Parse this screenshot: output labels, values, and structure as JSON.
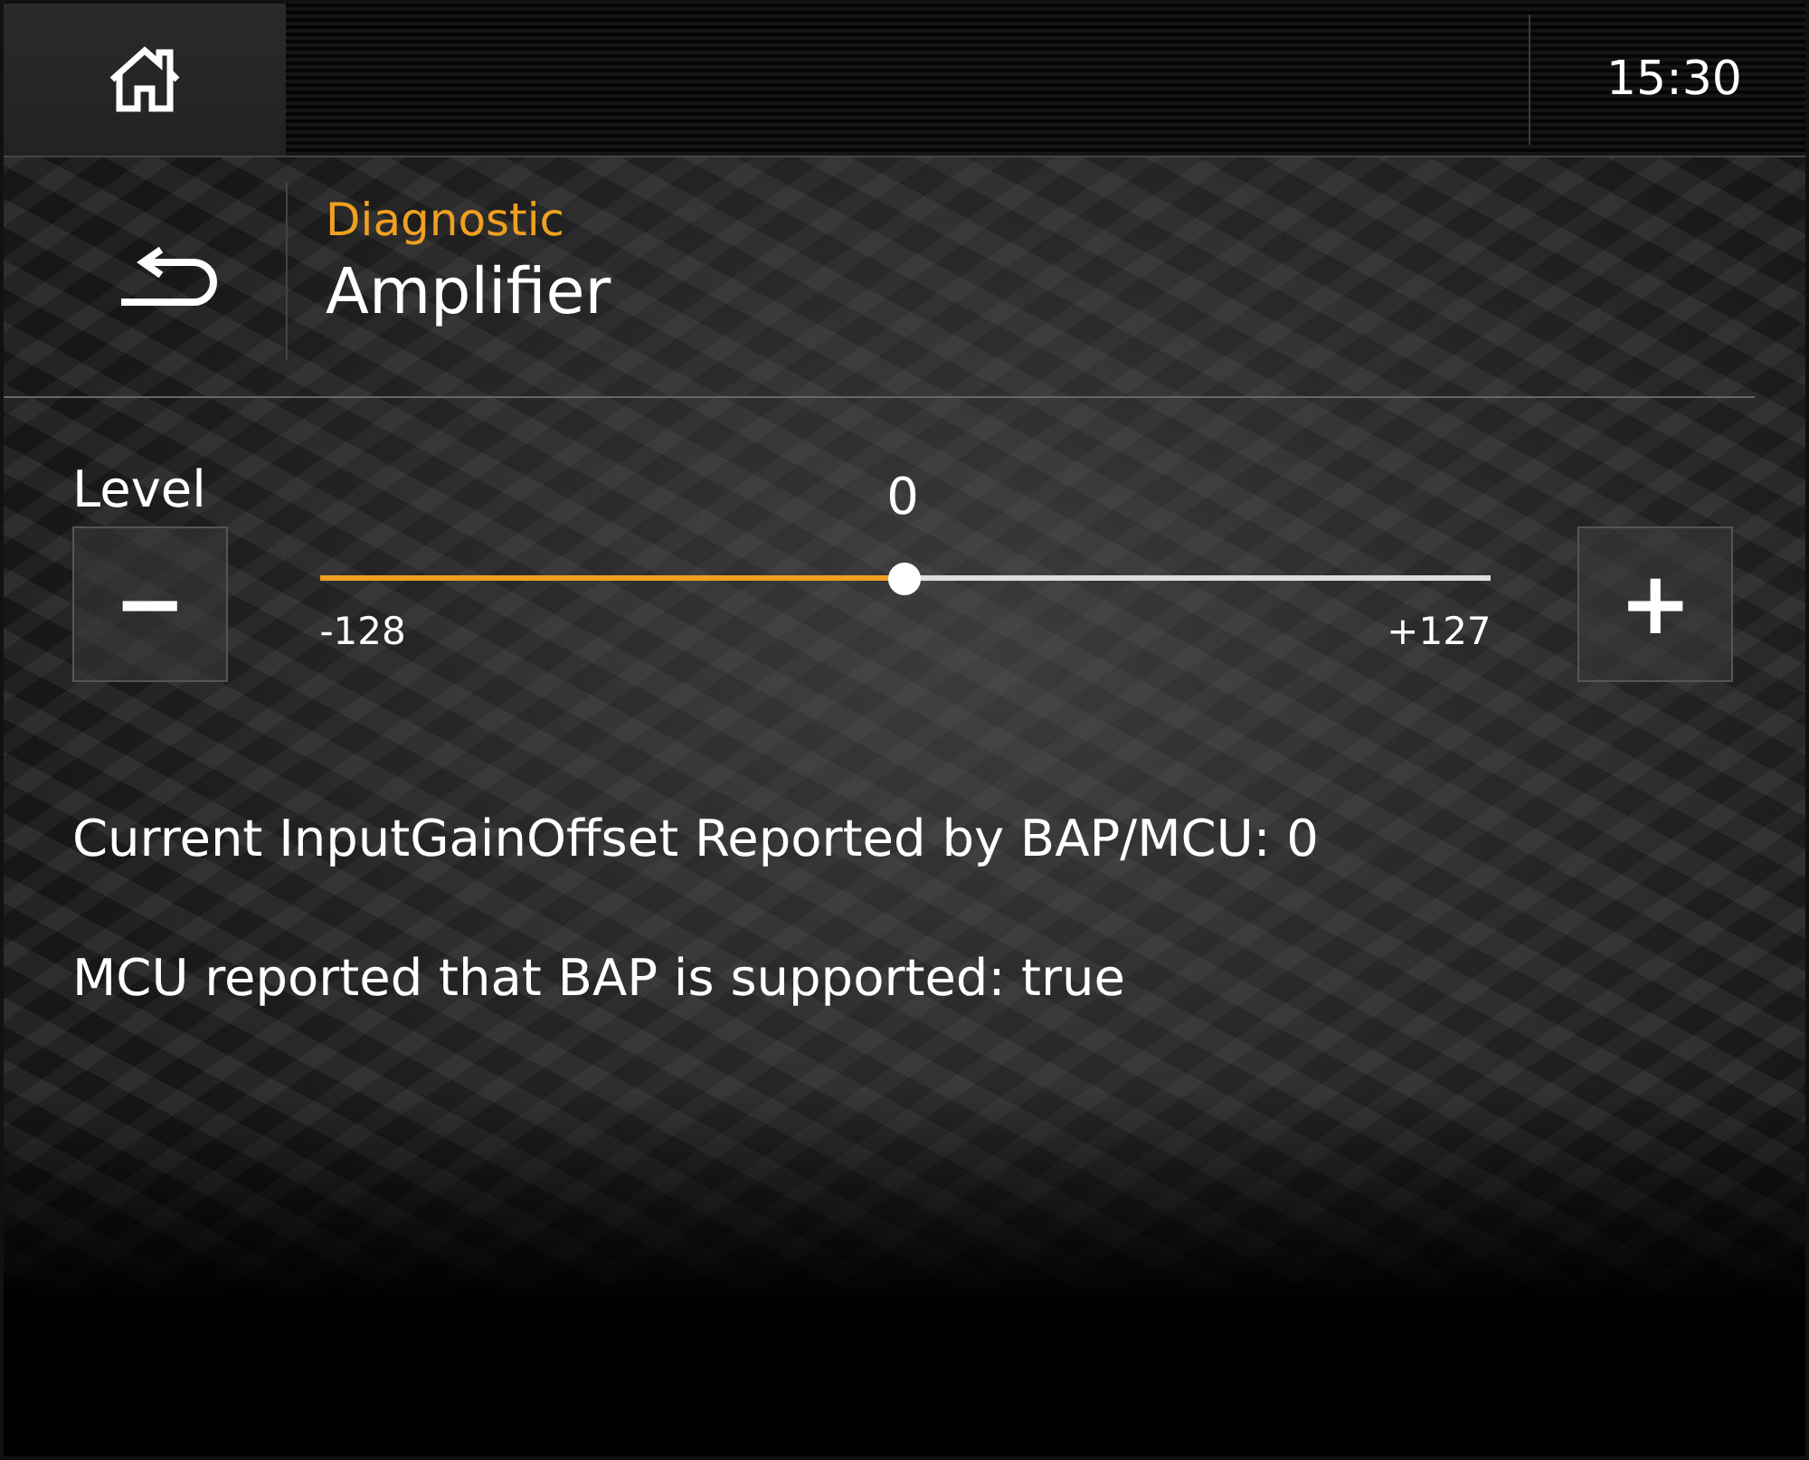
{
  "top_bar": {
    "clock": "15:30"
  },
  "header": {
    "breadcrumb": "Diagnostic",
    "title": "Amplifier"
  },
  "level_control": {
    "label": "Level",
    "value": "0",
    "decrease": "−",
    "increase": "+",
    "min_label": "-128",
    "max_label": "+127",
    "level": 0.5
  },
  "info_lines": [
    "Current InputGainOffset Reported by BAP/MCU: 0",
    "MCU reported that BAP is supported: true"
  ]
}
